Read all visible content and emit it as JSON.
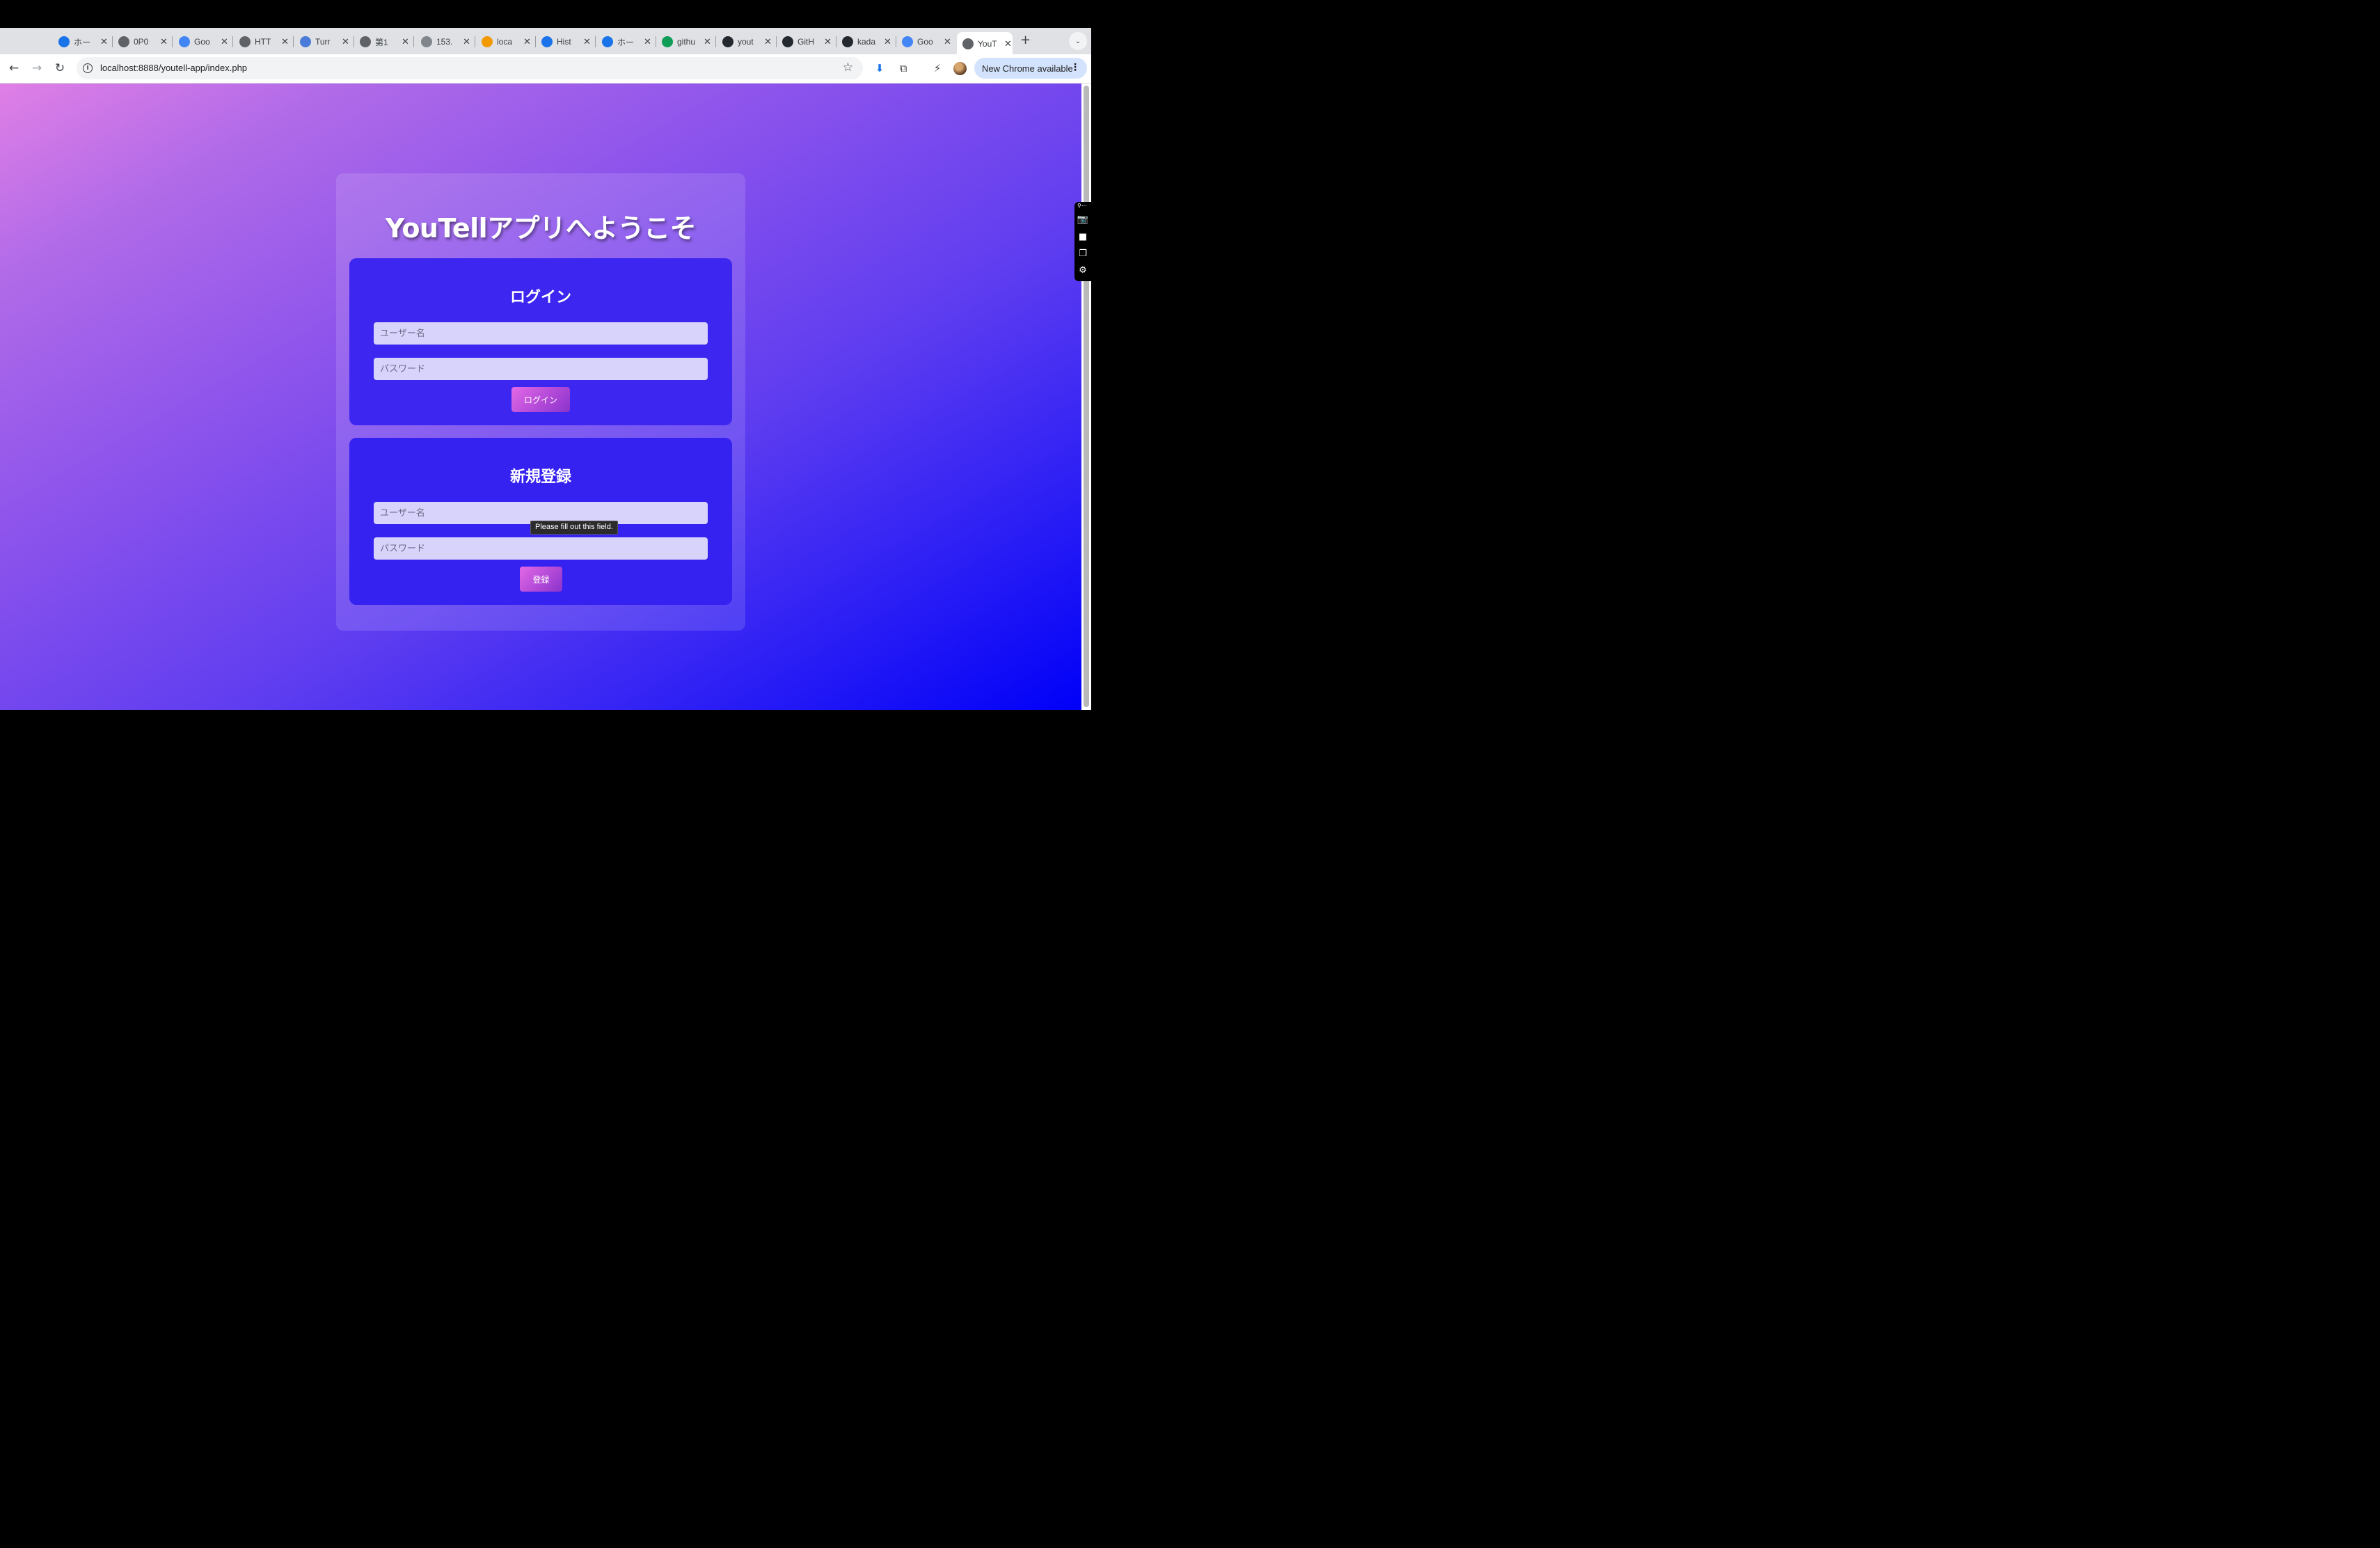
{
  "browser": {
    "tabs": [
      {
        "label": "ホー",
        "favicon_color": "#1a73e8",
        "favicon": "gdrive-icon"
      },
      {
        "label": "0P0",
        "favicon_color": "#5f6368",
        "favicon": "globe-icon"
      },
      {
        "label": "Goo",
        "favicon_color": "#4285f4",
        "favicon": "translate-icon"
      },
      {
        "label": "HTT",
        "favicon_color": "#5f6368",
        "favicon": "globe-icon"
      },
      {
        "label": "Turr",
        "favicon_color": "#4a7bd8",
        "favicon": "slash-icon"
      },
      {
        "label": "第1",
        "favicon_color": "#5f6368",
        "favicon": "profile-icon"
      },
      {
        "label": "153.",
        "favicon_color": "#80868b",
        "favicon": "globe-icon"
      },
      {
        "label": "loca",
        "favicon_color": "#f29900",
        "favicon": "pma-icon"
      },
      {
        "label": "Hist",
        "favicon_color": "#1a73e8",
        "favicon": "history-icon"
      },
      {
        "label": "ホー",
        "favicon_color": "#1a73e8",
        "favicon": "gdrive-icon"
      },
      {
        "label": "githu",
        "favicon_color": "#0f9d58",
        "favicon": "sheets-icon"
      },
      {
        "label": "yout",
        "favicon_color": "#24292f",
        "favicon": "github-icon"
      },
      {
        "label": "GitH",
        "favicon_color": "#24292f",
        "favicon": "github-icon"
      },
      {
        "label": "kada",
        "favicon_color": "#24292f",
        "favicon": "github-icon"
      },
      {
        "label": "Goo",
        "favicon_color": "#4285f4",
        "favicon": "translate-icon"
      },
      {
        "label": "YouT",
        "favicon_color": "#5f6368",
        "favicon": "globe-icon",
        "active": true
      }
    ],
    "url": "localhost:8888/youtell-app/index.php",
    "update_chip": "New Chrome available"
  },
  "page": {
    "title": "YouTellアプリへようこそ",
    "login": {
      "heading": "ログイン",
      "username_placeholder": "ユーザー名",
      "password_placeholder": "パスワード",
      "button": "ログイン"
    },
    "register": {
      "heading": "新規登録",
      "username_placeholder": "ユーザー名",
      "password_placeholder": "パスワード",
      "button": "登録"
    },
    "validation_tooltip": "Please fill out this field."
  }
}
